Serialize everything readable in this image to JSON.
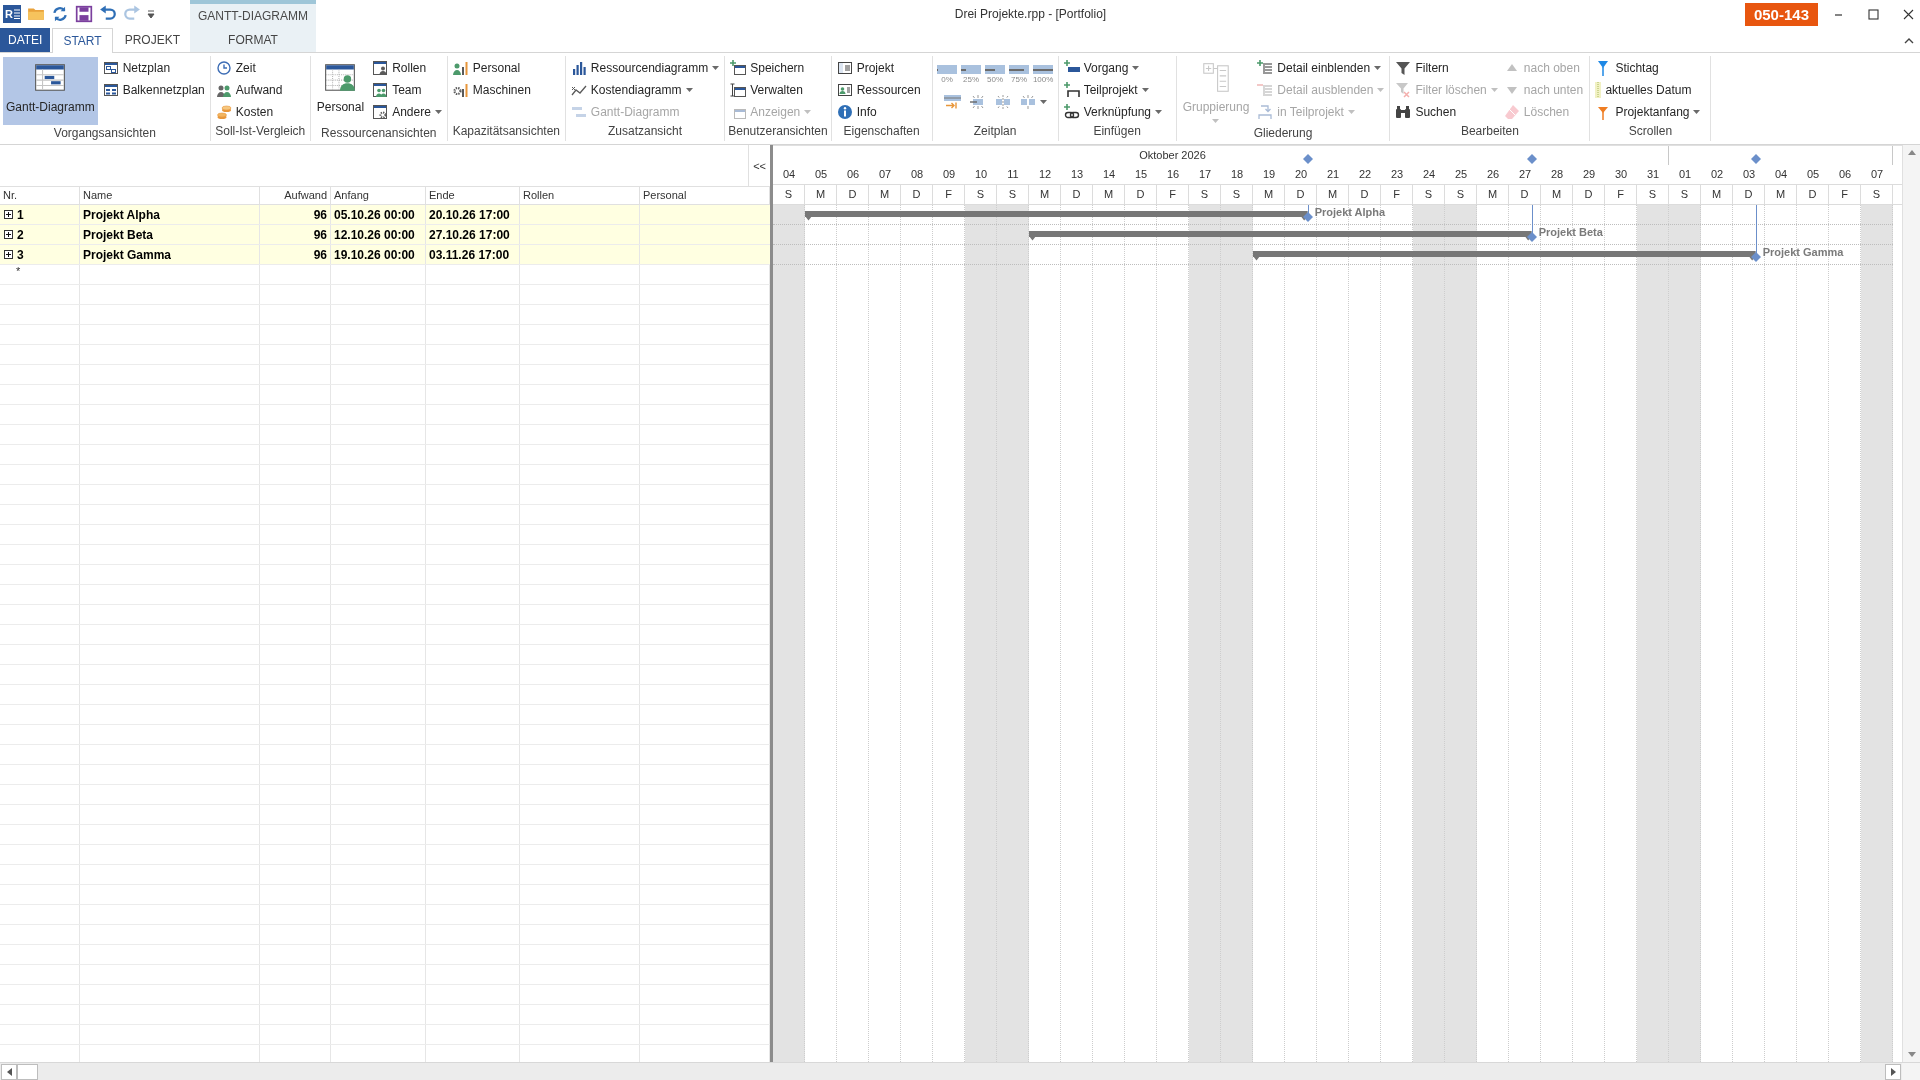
{
  "title_bar": {
    "logo_letter": "R",
    "quick_access": [
      {
        "disabled": false
      },
      {
        "disabled": false
      },
      {
        "disabled": false
      },
      {
        "disabled": false
      },
      {
        "disabled": true
      }
    ],
    "title": "Drei Projekte.rpp - [Portfolio]",
    "badge": "050-143"
  },
  "ribbon": {
    "context_group": "GANTT-DIAGRAMM",
    "tabs": [
      {
        "label": "DATEI",
        "kind": "file",
        "selected": false
      },
      {
        "label": "START",
        "kind": "main",
        "selected": true
      },
      {
        "label": "PROJEKT",
        "kind": "main",
        "selected": false
      },
      {
        "label": "FORMAT",
        "kind": "context",
        "selected": false
      }
    ],
    "groups": [
      {
        "label": "Vorgangsansichten",
        "items": [
          {
            "label": "Gantt-Diagramm",
            "kind": "large",
            "selected": true,
            "disabled": false
          },
          {
            "label": "Netzplan",
            "kind": "small",
            "selected": false,
            "disabled": false
          },
          {
            "label": "Balkennetzplan",
            "kind": "small",
            "selected": false,
            "disabled": false
          }
        ]
      },
      {
        "label": "Soll-Ist-Vergleich",
        "items": [
          {
            "label": "Zeit",
            "kind": "small",
            "disabled": false
          },
          {
            "label": "Aufwand",
            "kind": "small",
            "disabled": false
          },
          {
            "label": "Kosten",
            "kind": "small",
            "disabled": false
          }
        ]
      },
      {
        "label": "Ressourcenansichten",
        "items": [
          {
            "label": "Personal",
            "kind": "large",
            "disabled": false
          },
          {
            "label": "Rollen",
            "kind": "small",
            "disabled": false
          },
          {
            "label": "Team",
            "kind": "small",
            "disabled": false
          },
          {
            "label": "Andere",
            "kind": "small",
            "disabled": false,
            "dropdown": true
          }
        ]
      },
      {
        "label": "Kapazitätsansichten",
        "items": [
          {
            "label": "Personal",
            "kind": "small",
            "disabled": false
          },
          {
            "label": "Maschinen",
            "kind": "small",
            "disabled": false
          }
        ]
      },
      {
        "label": "Zusatzansicht",
        "items": [
          {
            "label": "Ressourcendiagramm",
            "kind": "small",
            "disabled": false,
            "dropdown": true
          },
          {
            "label": "Kostendiagramm",
            "kind": "small",
            "disabled": false,
            "dropdown": true
          },
          {
            "label": "Gantt-Diagramm",
            "kind": "small",
            "disabled": true
          }
        ]
      },
      {
        "label": "Benutzeransichten",
        "items": [
          {
            "label": "Speichern",
            "kind": "small",
            "disabled": false
          },
          {
            "label": "Verwalten",
            "kind": "small",
            "disabled": false
          },
          {
            "label": "Anzeigen",
            "kind": "small",
            "disabled": true,
            "dropdown": true
          }
        ]
      },
      {
        "label": "Eigenschaften",
        "items": [
          {
            "label": "Projekt",
            "kind": "small",
            "disabled": false
          },
          {
            "label": "Ressourcen",
            "kind": "small",
            "disabled": false
          },
          {
            "label": "Info",
            "kind": "small",
            "disabled": false
          }
        ]
      },
      {
        "label": "Zeitplan",
        "items": [
          {
            "label": "0%",
            "kind": "progress",
            "level": 0,
            "disabled": false
          },
          {
            "label": "25%",
            "kind": "progress",
            "level": 0.25,
            "disabled": false
          },
          {
            "label": "50%",
            "kind": "progress",
            "level": 0.5,
            "disabled": false
          },
          {
            "label": "75%",
            "kind": "progress",
            "level": 0.75,
            "disabled": false
          },
          {
            "label": "100%",
            "kind": "progress",
            "level": 1,
            "disabled": false
          },
          {
            "kind": "tool",
            "disabled": false
          },
          {
            "kind": "tool",
            "disabled": false
          },
          {
            "kind": "tool",
            "disabled": false
          },
          {
            "kind": "tool",
            "disabled": false,
            "dropdown": true
          }
        ]
      },
      {
        "label": "Einfügen",
        "items": [
          {
            "label": "Vorgang",
            "kind": "small",
            "disabled": false,
            "dropdown": true
          },
          {
            "label": "Teilprojekt",
            "kind": "small",
            "disabled": false,
            "dropdown": true
          },
          {
            "label": "Verknüpfung",
            "kind": "small",
            "disabled": false,
            "dropdown": true
          }
        ]
      },
      {
        "label": "Gliederung",
        "items": [
          {
            "label": "Gruppierung",
            "kind": "large",
            "disabled": true,
            "dropdown": true
          },
          {
            "label": "Detail einblenden",
            "kind": "small",
            "disabled": false,
            "dropdown": true
          },
          {
            "label": "Detail ausblenden",
            "kind": "small",
            "disabled": true,
            "dropdown": true
          },
          {
            "label": "in Teilprojekt",
            "kind": "small",
            "disabled": true,
            "dropdown": true
          }
        ]
      },
      {
        "label": "Bearbeiten",
        "items": [
          {
            "label": "Filtern",
            "kind": "small",
            "disabled": false
          },
          {
            "label": "Filter löschen",
            "kind": "small",
            "disabled": true,
            "dropdown": true
          },
          {
            "label": "Suchen",
            "kind": "small",
            "disabled": false
          },
          {
            "label": "nach oben",
            "kind": "small",
            "disabled": true
          },
          {
            "label": "nach unten",
            "kind": "small",
            "disabled": true
          },
          {
            "label": "Löschen",
            "kind": "small",
            "disabled": true
          }
        ]
      },
      {
        "label": "Scrollen",
        "items": [
          {
            "label": "Stichtag",
            "kind": "small",
            "disabled": false
          },
          {
            "label": "aktuelles Datum",
            "kind": "small",
            "disabled": false
          },
          {
            "label": "Projektanfang",
            "kind": "small",
            "disabled": false,
            "dropdown": true
          }
        ]
      }
    ]
  },
  "table": {
    "collapse_button": "<<",
    "columns": [
      "Nr.",
      "Name",
      "Aufwand",
      "Anfang",
      "Ende",
      "Rollen",
      "Personal"
    ],
    "rows": [
      {
        "nr": "1",
        "name": "Projekt Alpha",
        "effort": "96",
        "start": "05.10.26 00:00",
        "end": "20.10.26 17:00",
        "expanded": false
      },
      {
        "nr": "2",
        "name": "Projekt Beta",
        "effort": "96",
        "start": "12.10.26 00:00",
        "end": "27.10.26 17:00",
        "expanded": false
      },
      {
        "nr": "3",
        "name": "Projekt Gamma",
        "effort": "96",
        "start": "19.10.26 00:00",
        "end": "03.11.26 17:00",
        "expanded": false
      }
    ],
    "new_row_marker": "*"
  },
  "gantt": {
    "month_label": "Oktober 2026",
    "days": [
      {
        "day": "04",
        "weekday": "S",
        "weekend": true
      },
      {
        "day": "05",
        "weekday": "M",
        "weekend": false
      },
      {
        "day": "06",
        "weekday": "D",
        "weekend": false
      },
      {
        "day": "07",
        "weekday": "M",
        "weekend": false
      },
      {
        "day": "08",
        "weekday": "D",
        "weekend": false
      },
      {
        "day": "09",
        "weekday": "F",
        "weekend": false
      },
      {
        "day": "10",
        "weekday": "S",
        "weekend": true
      },
      {
        "day": "11",
        "weekday": "S",
        "weekend": true
      },
      {
        "day": "12",
        "weekday": "M",
        "weekend": false
      },
      {
        "day": "13",
        "weekday": "D",
        "weekend": false
      },
      {
        "day": "14",
        "weekday": "M",
        "weekend": false
      },
      {
        "day": "15",
        "weekday": "D",
        "weekend": false
      },
      {
        "day": "16",
        "weekday": "F",
        "weekend": false
      },
      {
        "day": "17",
        "weekday": "S",
        "weekend": true
      },
      {
        "day": "18",
        "weekday": "S",
        "weekend": true
      },
      {
        "day": "19",
        "weekday": "M",
        "weekend": false
      },
      {
        "day": "20",
        "weekday": "D",
        "weekend": false
      },
      {
        "day": "21",
        "weekday": "M",
        "weekend": false
      },
      {
        "day": "22",
        "weekday": "D",
        "weekend": false
      },
      {
        "day": "23",
        "weekday": "F",
        "weekend": false
      },
      {
        "day": "24",
        "weekday": "S",
        "weekend": true
      },
      {
        "day": "25",
        "weekday": "S",
        "weekend": true
      },
      {
        "day": "26",
        "weekday": "M",
        "weekend": false
      },
      {
        "day": "27",
        "weekday": "D",
        "weekend": false
      },
      {
        "day": "28",
        "weekday": "M",
        "weekend": false
      },
      {
        "day": "29",
        "weekday": "D",
        "weekend": false
      },
      {
        "day": "30",
        "weekday": "F",
        "weekend": false
      },
      {
        "day": "31",
        "weekday": "S",
        "weekend": true
      },
      {
        "day": "01",
        "weekday": "S",
        "weekend": true
      },
      {
        "day": "02",
        "weekday": "M",
        "weekend": false
      },
      {
        "day": "03",
        "weekday": "D",
        "weekend": false
      },
      {
        "day": "04",
        "weekday": "M",
        "weekend": false
      },
      {
        "day": "05",
        "weekday": "D",
        "weekend": false
      },
      {
        "day": "06",
        "weekday": "F",
        "weekend": false
      },
      {
        "day": "07",
        "weekday": "S",
        "weekend": true
      }
    ],
    "bar_labels": [
      "Projekt Alpha",
      "Projekt Beta",
      "Projekt Gamma"
    ]
  }
}
